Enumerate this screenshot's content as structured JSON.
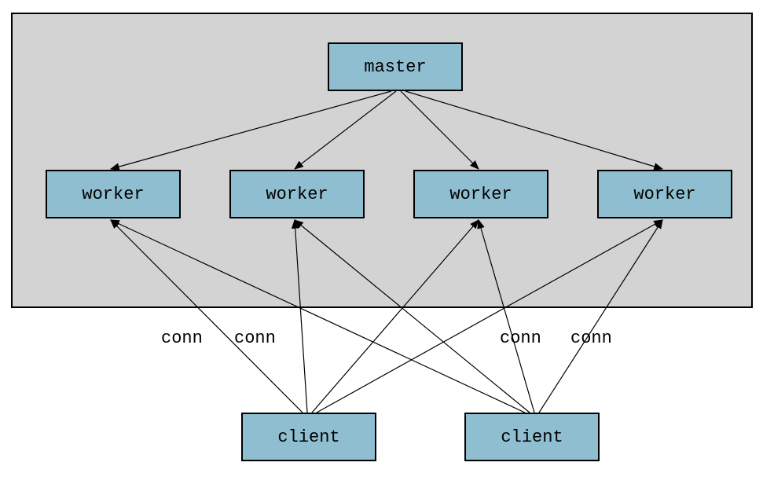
{
  "nodes": {
    "master": {
      "label": "master"
    },
    "worker1": {
      "label": "worker"
    },
    "worker2": {
      "label": "worker"
    },
    "worker3": {
      "label": "worker"
    },
    "worker4": {
      "label": "worker"
    },
    "client1": {
      "label": "client"
    },
    "client2": {
      "label": "client"
    }
  },
  "edgeLabels": {
    "conn1": "conn",
    "conn2": "conn",
    "conn3": "conn",
    "conn4": "conn"
  },
  "layout": {
    "containerBg": "#d3d3d3",
    "nodeBg": "#8fbed1",
    "nodeBorder": "#000000"
  },
  "diagram": {
    "type": "architecture",
    "description": "Master-worker architecture with external clients connecting to workers",
    "edges": [
      {
        "from": "master",
        "to": "worker1"
      },
      {
        "from": "master",
        "to": "worker2"
      },
      {
        "from": "master",
        "to": "worker3"
      },
      {
        "from": "master",
        "to": "worker4"
      },
      {
        "from": "client1",
        "to": "worker1",
        "label": "conn"
      },
      {
        "from": "client1",
        "to": "worker2",
        "label": "conn"
      },
      {
        "from": "client1",
        "to": "worker3"
      },
      {
        "from": "client1",
        "to": "worker4"
      },
      {
        "from": "client2",
        "to": "worker1"
      },
      {
        "from": "client2",
        "to": "worker2"
      },
      {
        "from": "client2",
        "to": "worker3",
        "label": "conn"
      },
      {
        "from": "client2",
        "to": "worker4",
        "label": "conn"
      }
    ]
  }
}
